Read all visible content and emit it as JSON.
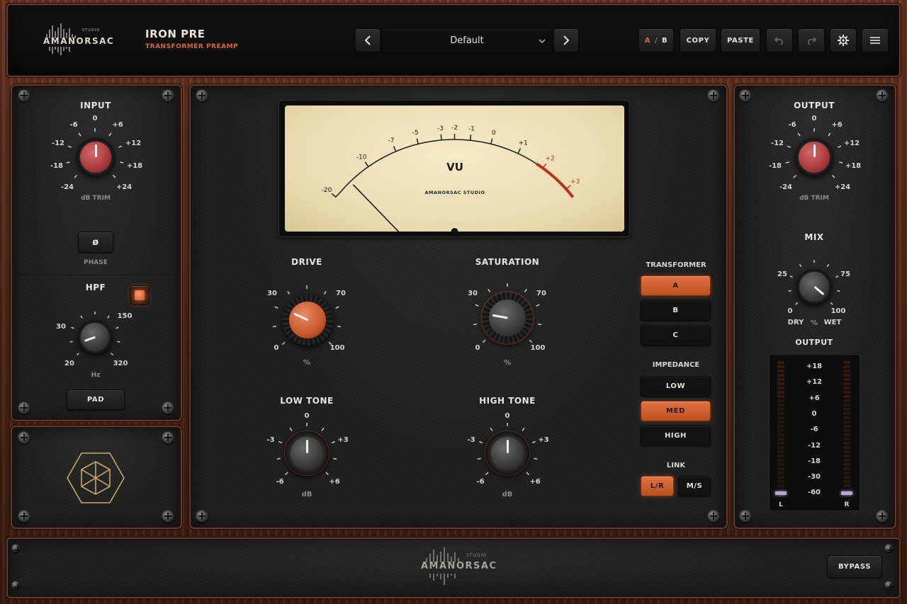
{
  "header": {
    "brand": "AMANORSAC",
    "brand_small": "STUDIO",
    "product_title": "IRON PRE",
    "product_subtitle": "TRANSFORMER PREAMP",
    "preset_name": "Default",
    "ab_a": "A",
    "ab_sep": "/",
    "ab_b": "B",
    "copy": "COPY",
    "paste": "PASTE"
  },
  "input": {
    "title": "INPUT",
    "unit": "dB TRIM",
    "scale": [
      "-24",
      "-18",
      "-12",
      "-6",
      "0",
      "+6",
      "+12",
      "+18",
      "+24"
    ],
    "value_db": 0
  },
  "phase": {
    "button": "ø",
    "label": "PHASE"
  },
  "hpf": {
    "title": "HPF",
    "unit": "Hz",
    "scale": [
      "20",
      "30",
      "150",
      "320"
    ],
    "enabled": true,
    "pad_label": "PAD"
  },
  "vu": {
    "title": "VU",
    "maker": "AMANORSAC STUDIO",
    "scale": [
      "-20",
      "-10",
      "-7",
      "-5",
      "-3",
      "-2",
      "-1",
      "0",
      "+1",
      "+2",
      "+3"
    ],
    "colors": {
      "face": "#efe3c0",
      "red": "#c0301e",
      "ink": "#1b1b1b"
    }
  },
  "drive": {
    "title": "DRIVE",
    "unit": "%",
    "scale": [
      "0",
      "30",
      "70",
      "100"
    ]
  },
  "saturation": {
    "title": "SATURATION",
    "unit": "%",
    "scale": [
      "0",
      "30",
      "70",
      "100"
    ]
  },
  "low_tone": {
    "title": "LOW TONE",
    "unit": "dB",
    "scale": [
      "-6",
      "-3",
      "0",
      "+3",
      "+6"
    ],
    "value_db": 0
  },
  "high_tone": {
    "title": "HIGH TONE",
    "unit": "dB",
    "scale": [
      "-6",
      "-3",
      "0",
      "+3",
      "+6"
    ],
    "value_db": 0
  },
  "transformer": {
    "title": "TRANSFORMER",
    "options": [
      "A",
      "B",
      "C"
    ],
    "selected": "A"
  },
  "impedance": {
    "title": "IMPEDANCE",
    "options": [
      "LOW",
      "MED",
      "HIGH"
    ],
    "selected": "MED"
  },
  "link": {
    "title": "LINK",
    "options": [
      "L/R",
      "M/S"
    ],
    "selected": "L/R"
  },
  "output": {
    "title": "OUTPUT",
    "unit": "dB TRIM",
    "scale": [
      "-24",
      "-18",
      "-12",
      "-6",
      "0",
      "+6",
      "+12",
      "+18",
      "+24"
    ],
    "value_db": 0
  },
  "mix": {
    "title": "MIX",
    "scale": [
      "0",
      "25",
      "75",
      "100"
    ],
    "dry": "DRY",
    "unit": "%",
    "wet": "WET"
  },
  "meter": {
    "title": "OUTPUT",
    "scale": [
      "+18",
      "+12",
      "+6",
      "0",
      "-6",
      "-12",
      "-18",
      "-30",
      "-60"
    ],
    "left": "L",
    "right": "R"
  },
  "footer": {
    "brand": "AMANORSAC",
    "brand_small": "STUDIO",
    "bypass": "BYPASS"
  },
  "colors": {
    "accent": "#d9663a",
    "accent_dark": "#b9501f",
    "panel": "#1f1f1e",
    "wood": "#5a2c1a"
  }
}
